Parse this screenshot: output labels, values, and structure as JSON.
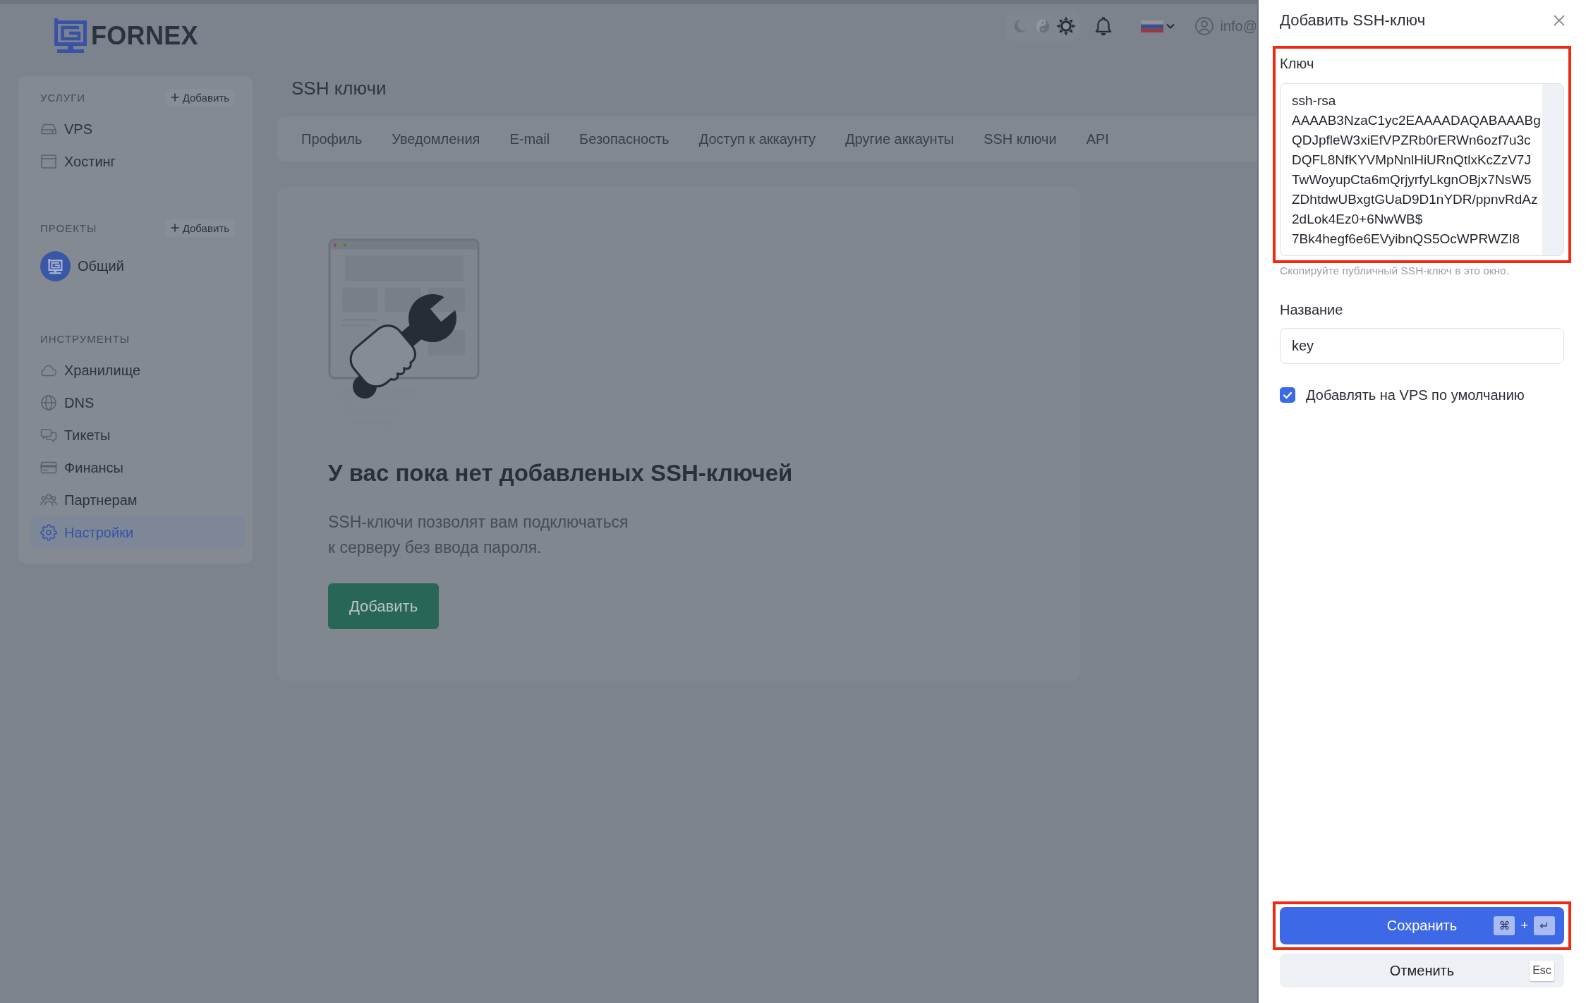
{
  "header": {
    "logo": "FORNEX",
    "theme_options": [
      {
        "kind": "dark",
        "selected": false
      },
      {
        "kind": "auto",
        "selected": false
      },
      {
        "kind": "light",
        "selected": true
      }
    ],
    "user": "info@"
  },
  "sidebar": {
    "sections": [
      {
        "title": "УСЛУГИ",
        "action": "Добавить",
        "items": [
          {
            "kind": "link",
            "label": "VPS",
            "selected": false
          },
          {
            "kind": "link",
            "label": "Хостинг",
            "selected": false
          }
        ]
      },
      {
        "title": "ПРОЕКТЫ",
        "action": "Добавить",
        "items": [
          {
            "kind": "project",
            "label": "Общий",
            "selected": false
          }
        ]
      },
      {
        "title": "ИНСТРУМЕНТЫ",
        "items": [
          {
            "kind": "link",
            "label": "Хранилище",
            "selected": false
          },
          {
            "kind": "link",
            "label": "DNS",
            "selected": false
          },
          {
            "kind": "link",
            "label": "Тикеты",
            "selected": false
          },
          {
            "kind": "link",
            "label": "Финансы",
            "selected": false
          },
          {
            "kind": "link",
            "label": "Партнерам",
            "selected": false
          },
          {
            "kind": "link",
            "label": "Настройки",
            "selected": true
          }
        ]
      }
    ]
  },
  "page": {
    "title": "SSH ключи",
    "tabs": [
      {
        "label": "Профиль"
      },
      {
        "label": "Уведомления"
      },
      {
        "label": "E-mail"
      },
      {
        "label": "Безопасность"
      },
      {
        "label": "Доступ к аккаунту"
      },
      {
        "label": "Другие аккаунты"
      },
      {
        "label": "SSH ключи"
      },
      {
        "label": "API"
      }
    ],
    "empty_state": {
      "title": "У вас пока нет добавленых SSH-ключей",
      "description": "SSH-ключи позволят вам подключаться\nк серверу без ввода пароля.",
      "button": "Добавить"
    }
  },
  "drawer": {
    "title": "Добавить SSH-ключ",
    "key_field": {
      "label": "Ключ",
      "value": "ssh-rsa\nAAAAB3NzaC1yc2EAAAADAQABAAABg\nQDJpfleW3xiEfVPZRb0rERWn6ozf7u3c\nDQFL8NfKYVMpNnlHiURnQtlxKcZzV7J\nTwWoyupCta6mQrjyrfyLkgnOBjx7NsW5\nZDhtdwUBxgtGUaD9D1nYDR/ppnvRdAz\n2dLok4Ez0+6NwWB$\n7Bk4hegf6e6EVyibnQS5OcWPRWZI8",
      "hint": "Скопируйте публичный SSH-ключ в это окно.",
      "highlighted": true
    },
    "name_field": {
      "label": "Название",
      "value": "key"
    },
    "default_vps": {
      "label": "Добавлять на VPS по умолчанию",
      "checked": true
    },
    "save_button": {
      "label": "Сохранить",
      "keys": [
        "⌘",
        "↵"
      ],
      "joiner": "+",
      "highlighted": true
    },
    "cancel_button": {
      "label": "Отменить",
      "keys": [
        "Esc"
      ]
    }
  }
}
